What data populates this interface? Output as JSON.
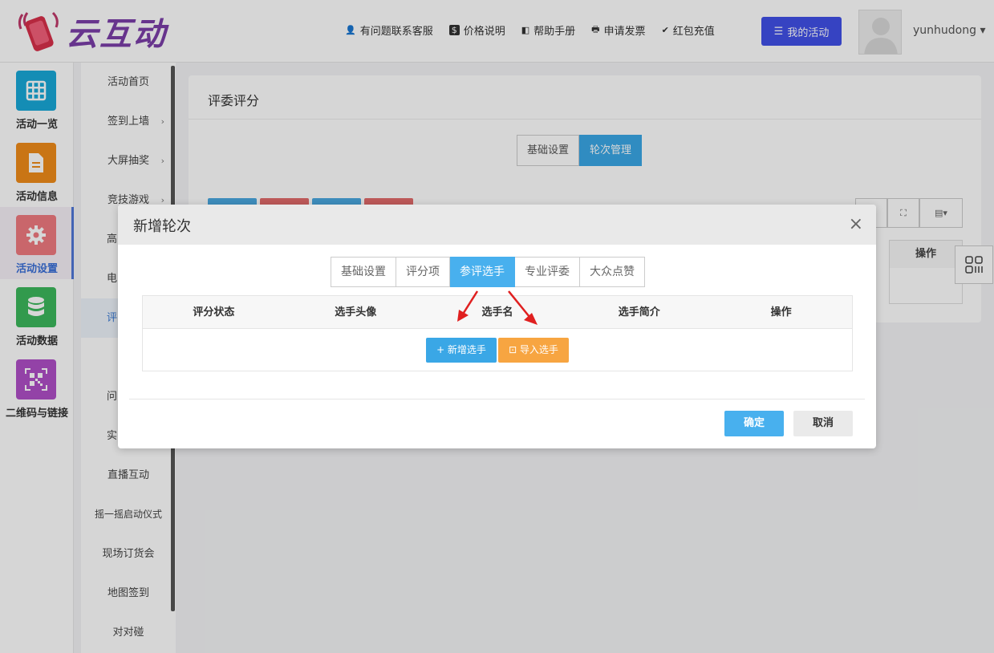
{
  "header": {
    "logo_text": "云互动",
    "nav": [
      {
        "icon": "user-plus-icon",
        "glyph": "👤",
        "label": "有问题联系客服"
      },
      {
        "icon": "dollar-icon",
        "glyph": "$",
        "label": "价格说明"
      },
      {
        "icon": "book-icon",
        "glyph": "◧",
        "label": "帮助手册"
      },
      {
        "icon": "printer-icon",
        "glyph": "🖶",
        "label": "申请发票"
      },
      {
        "icon": "shield-check-icon",
        "glyph": "✔",
        "label": "红包充值"
      }
    ],
    "my_activity": "我的活动",
    "username": "yunhudong ▾"
  },
  "iconbar": [
    {
      "label": "活动一览",
      "color": "#19a8d8"
    },
    {
      "label": "活动信息",
      "color": "#f08c1a"
    },
    {
      "label": "活动设置",
      "color": "#f07a80"
    },
    {
      "label": "活动数据",
      "color": "#3cb85c"
    },
    {
      "label": "二维码与链接",
      "color": "#b04fc8"
    }
  ],
  "submenu": [
    {
      "label": "活动首页",
      "chev": ""
    },
    {
      "label": "签到上墙",
      "chev": "›"
    },
    {
      "label": "大屏抽奖",
      "chev": "›"
    },
    {
      "label": "竞技游戏",
      "chev": "›"
    },
    {
      "label": "高",
      "chev": ""
    },
    {
      "label": "电",
      "chev": ""
    },
    {
      "label": "评",
      "chev": ""
    },
    {
      "label": "",
      "chev": ""
    },
    {
      "label": "问",
      "chev": ""
    },
    {
      "label": "实",
      "chev": ""
    },
    {
      "label": "直播互动",
      "chev": ""
    },
    {
      "label": "摇一摇启动仪式",
      "chev": ""
    },
    {
      "label": "现场订货会",
      "chev": ""
    },
    {
      "label": "地图签到",
      "chev": ""
    },
    {
      "label": "对对碰",
      "chev": ""
    }
  ],
  "panel": {
    "title": "评委评分",
    "tabs": [
      "基础设置",
      "轮次管理"
    ],
    "active_tab": 1,
    "op_header": "操作",
    "btn_colors": [
      "#4aa8e0",
      "#e26a6a",
      "#4aa8e0",
      "#e26a6a"
    ]
  },
  "modal": {
    "title": "新增轮次",
    "close": "×",
    "tabs": [
      "基础设置",
      "评分项",
      "参评选手",
      "专业评委",
      "大众点赞"
    ],
    "active_tab": 2,
    "columns": [
      "评分状态",
      "选手头像",
      "选手名",
      "选手简介",
      "操作"
    ],
    "add_player": "+ 新增选手",
    "import_player": "⊡ 导入选手",
    "ok": "确定",
    "cancel": "取消"
  },
  "colors": {
    "accent": "#48b0ee",
    "brand": "#7b3fa8",
    "primary_nav": "#4150e8",
    "warning": "#f7a541",
    "arrow": "#e02020"
  }
}
